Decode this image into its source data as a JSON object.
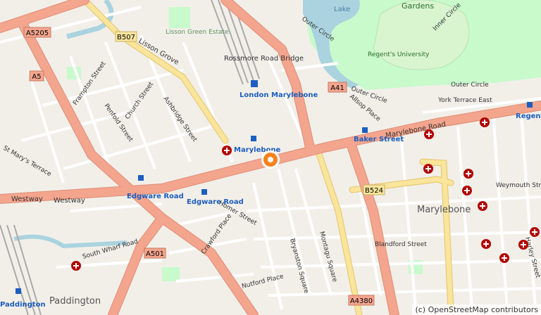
{
  "map": {
    "area_label": "Marylebone",
    "attribution": "(c) OpenStreetMap contributors",
    "colors": {
      "land": "#f2efe9",
      "primary_road": "#f4a58e",
      "secondary_road": "#f9e59b",
      "minor_road": "#ffffff",
      "park": "#c8facc",
      "water": "#aad3df",
      "rail": "#999999",
      "hospital": "#b30000",
      "marker": "#f5821f",
      "station_text": "#1c5ec1"
    },
    "marker": {
      "name": "location-marker"
    },
    "road_shields": {
      "a5205": "A5205",
      "b507": "B507",
      "a5": "A5",
      "a41": "A41",
      "b524": "B524",
      "a501": "A501",
      "a4380": "A4380"
    },
    "stations": {
      "london_marylebone": "London Marylebone",
      "marylebone": "Marylebone",
      "baker_street": "Baker Street",
      "edgware_road_west": "Edgware Road",
      "edgware_road_east": "Edgware Road",
      "regents_park": "Regent's Park",
      "paddington": "Paddington"
    },
    "labels": {
      "lake": "Lake",
      "gardens": "Gardens",
      "lisson_green": "Lisson Green Estate",
      "regents_university": "Regent's University",
      "inner_circle": "Inner Circle",
      "outer_circle_1": "Outer Circle",
      "outer_circle_2": "Outer Circle",
      "outer_circle_3": "Outer Circle",
      "rossmore": "Rossmore Road Bridge",
      "lisson_grove": "Lisson Grove",
      "frampton": "Frampton Street",
      "penfold": "Penfold Street",
      "church": "Church Street",
      "ashbridge": "Ashbridge Street",
      "st_marys": "St Mary's Terrace",
      "westway_1": "Westway",
      "westway_2": "Westway",
      "marylebone_road": "Marylebone Road",
      "allsop": "Allsop Place",
      "york_terrace": "York Terrace East",
      "homer": "Homer Street",
      "crawford": "Crawford Place",
      "south_wharf": "South Wharf Road",
      "nutford": "Nutford Place",
      "bryanston": "Bryanston Square",
      "montagu": "Montagu Square",
      "blandford": "Blandford Street",
      "weymouth": "Weymouth Street",
      "harley": "Harley Street",
      "paddington_area": "Paddington",
      "marylebone_area": "Marylebone"
    }
  }
}
